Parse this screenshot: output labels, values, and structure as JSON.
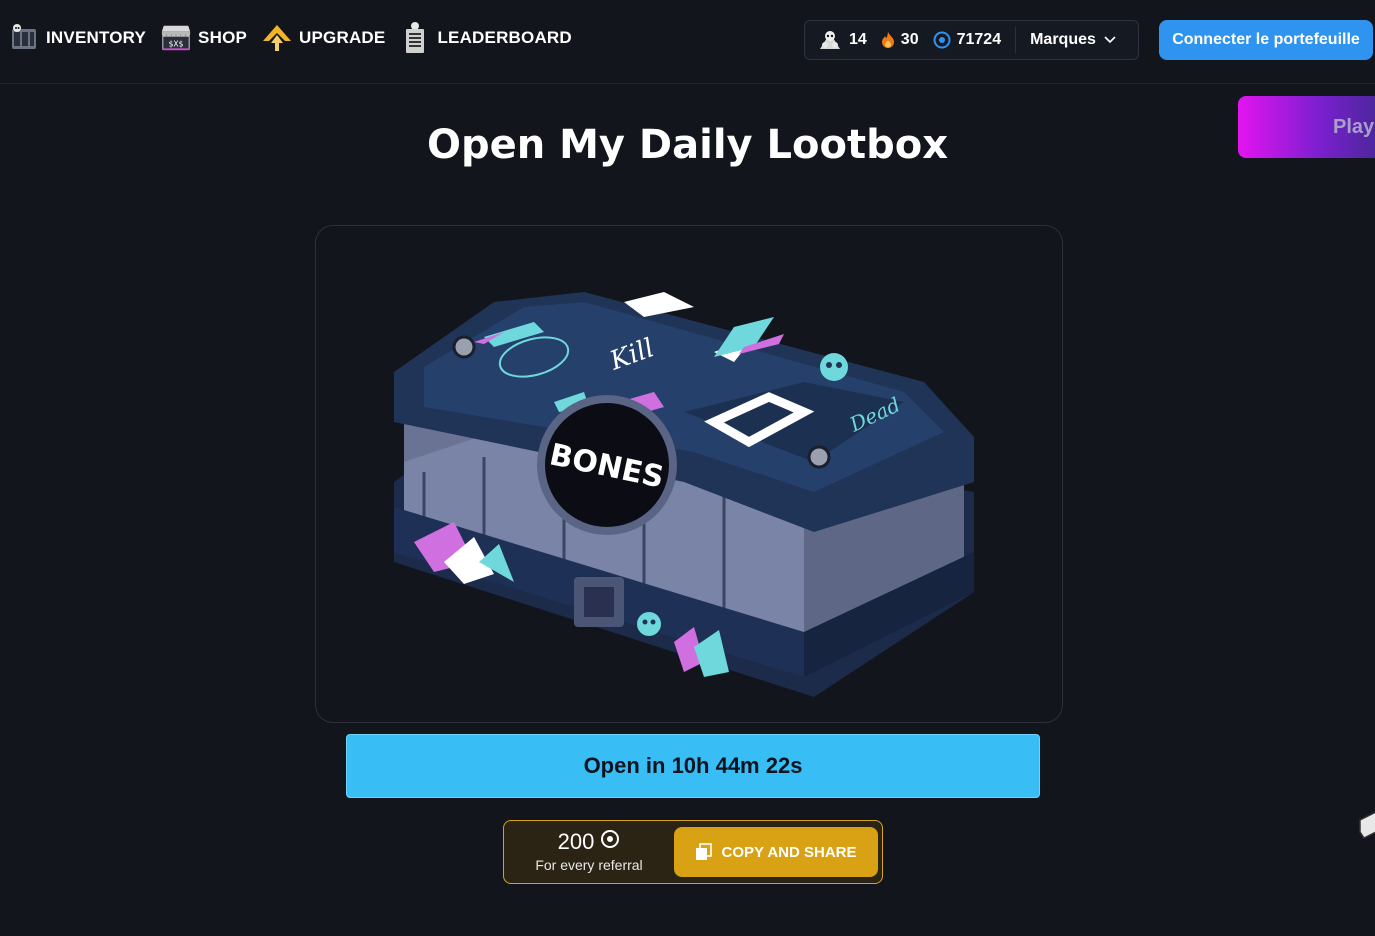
{
  "nav": {
    "items": [
      {
        "label": "INVENTORY",
        "icon": "inventory-icon"
      },
      {
        "label": "SHOP",
        "icon": "shop-icon"
      },
      {
        "label": "UPGRADE",
        "icon": "upgrade-icon"
      },
      {
        "label": "LEADERBOARD",
        "icon": "leaderboard-icon"
      }
    ]
  },
  "stats": {
    "bones": "14",
    "fire": "30",
    "coins": "71724",
    "language": "Marques"
  },
  "wallet": {
    "label": "Connecter le portefeuille"
  },
  "play": {
    "label": "Play"
  },
  "page": {
    "title": "Open My Daily Lootbox"
  },
  "lootbox": {
    "brand": "BONES",
    "kill_text": "Kill",
    "dead_text": "Dead"
  },
  "open_button": {
    "label": "Open in 10h 44m 22s"
  },
  "referral": {
    "amount": "200",
    "subtitle": "For every referral",
    "copy_label": "COPY AND SHARE"
  },
  "colors": {
    "background": "#12151c",
    "wallet_blue": "#2f93f0",
    "open_cyan": "#38bdf5",
    "referral_gold": "#d9a114",
    "play_magenta": "#e314f0"
  }
}
